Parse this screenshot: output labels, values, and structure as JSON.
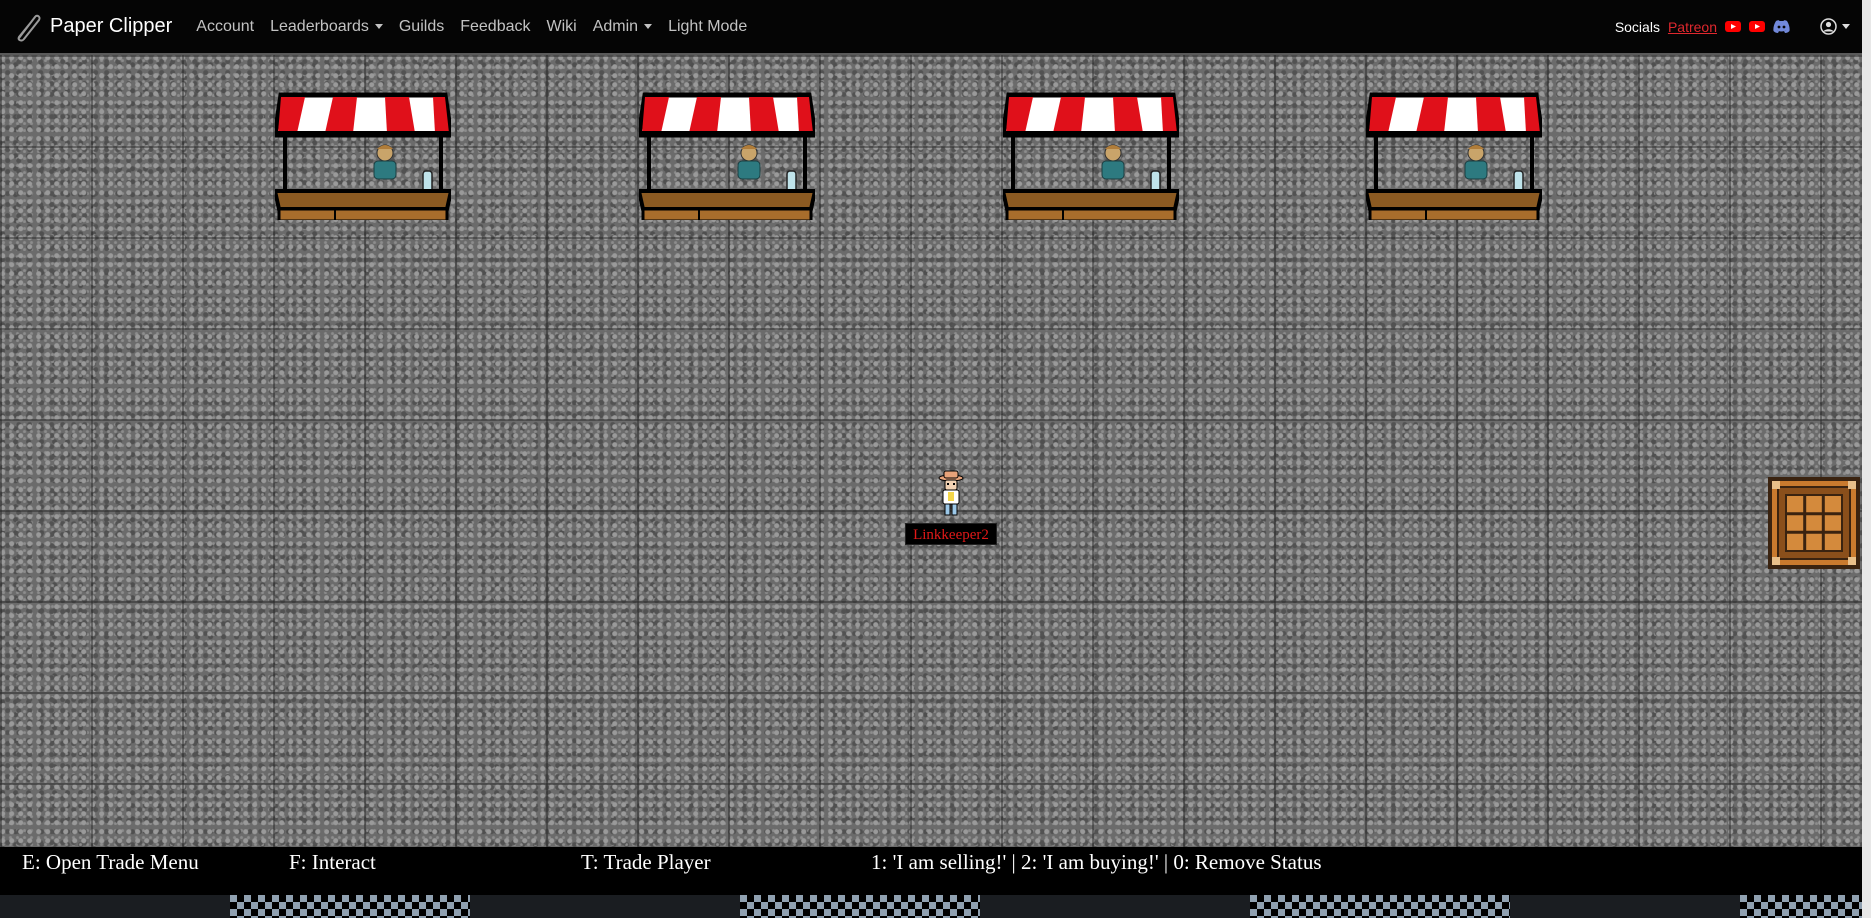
{
  "navbar": {
    "brand": "Paper Clipper",
    "links": [
      {
        "label": "Account",
        "dropdown": false
      },
      {
        "label": "Leaderboards",
        "dropdown": true
      },
      {
        "label": "Guilds",
        "dropdown": false
      },
      {
        "label": "Feedback",
        "dropdown": false
      },
      {
        "label": "Wiki",
        "dropdown": false
      },
      {
        "label": "Admin",
        "dropdown": true
      },
      {
        "label": "Light Mode",
        "dropdown": false
      }
    ],
    "socials_label": "Socials",
    "patreon_label": "Patreon",
    "icons": [
      "youtube-icon",
      "youtube-icon",
      "discord-icon",
      "user-circle-icon"
    ]
  },
  "game": {
    "stalls": [
      "market-stall",
      "market-stall",
      "market-stall",
      "market-stall"
    ],
    "player": {
      "name": "Linkkeeper2"
    },
    "objects": [
      "crafting-table"
    ]
  },
  "hotkeys": {
    "open_trade": "E: Open Trade Menu",
    "interact": "F: Interact",
    "trade_player": "T: Trade Player",
    "status": "1: 'I am selling!' | 2: 'I am buying!' | 0: Remove Status"
  },
  "colors": {
    "navbar_bg": "#050505",
    "nav_link": "#c2c2c2",
    "patreon": "#e0282e",
    "youtube": "#ff0000",
    "discord": "#5865f2",
    "awning_red": "#e0101a",
    "player_name": "#e01818"
  }
}
